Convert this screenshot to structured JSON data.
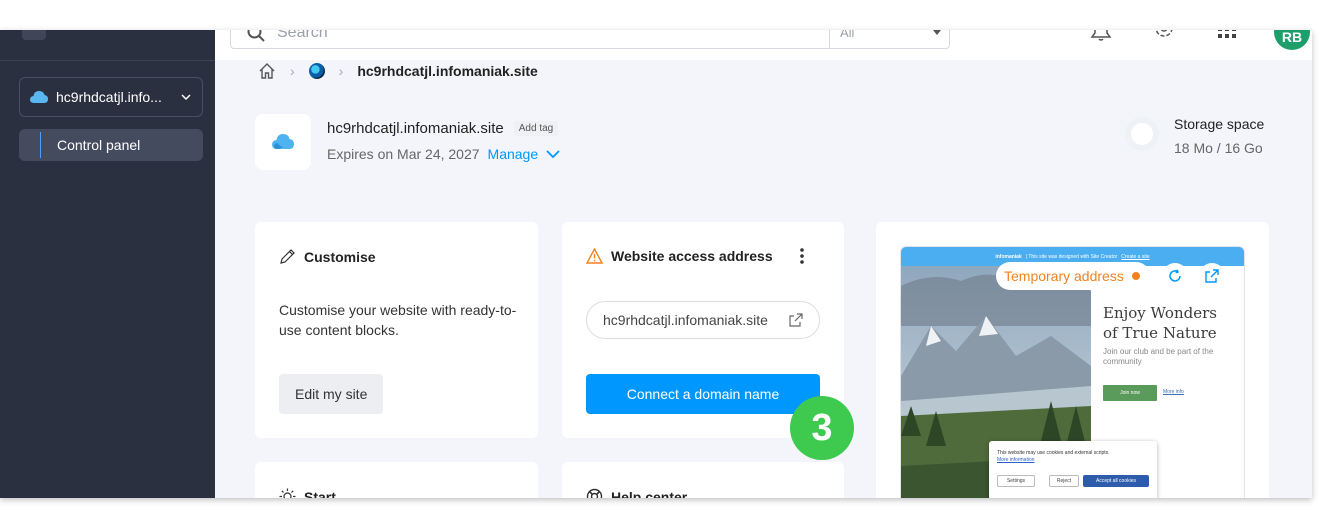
{
  "topbar": {
    "search_placeholder": "Search",
    "filter_label": "All",
    "avatar_initials": "RB",
    "icons": [
      "bell-icon",
      "gear-icon",
      "apps-grid-icon"
    ]
  },
  "sidebar": {
    "site_selector_label": "hc9rhdcatjl.info...",
    "items": [
      {
        "label": "Control panel",
        "active": true
      }
    ]
  },
  "breadcrumb": {
    "current": "hc9rhdcatjl.infomaniak.site"
  },
  "site": {
    "name": "hc9rhdcatjl.infomaniak.site",
    "add_tag": "Add tag",
    "expires": "Expires on Mar 24, 2027",
    "manage": "Manage"
  },
  "storage": {
    "title": "Storage space",
    "value": "18 Mo / 16 Go"
  },
  "cards": {
    "customise": {
      "title": "Customise",
      "text": "Customise your website with ready-to-use content blocks.",
      "button": "Edit my site"
    },
    "access": {
      "title": "Website access address",
      "address": "hc9rhdcatjl.infomaniak.site",
      "button": "Connect a domain name"
    },
    "start": {
      "title": "Start"
    },
    "help": {
      "title": "Help center"
    }
  },
  "step_badge": "3",
  "preview": {
    "temp_address": "Temporary address",
    "bar_brand": "infomaniak",
    "bar_text": "| This site was designed with Site Creator",
    "bar_link": "Create a site",
    "heading": "Enjoy Wonders of True Nature",
    "subtitle": "Join our club and be part of the community",
    "join_button": "Join now",
    "more_link": "More info",
    "cookie_text": "This website may use cookies and external scripts.",
    "cookie_link": "More information",
    "cookie_settings": "Settings",
    "cookie_reject": "Reject",
    "cookie_accept": "Accept all cookies"
  },
  "colors": {
    "sidebar_bg": "#2b3040",
    "page_bg": "#f3f5fb",
    "accent_blue": "#0098ff",
    "warning_orange": "#f0831e",
    "badge_green": "#3ec94f"
  }
}
